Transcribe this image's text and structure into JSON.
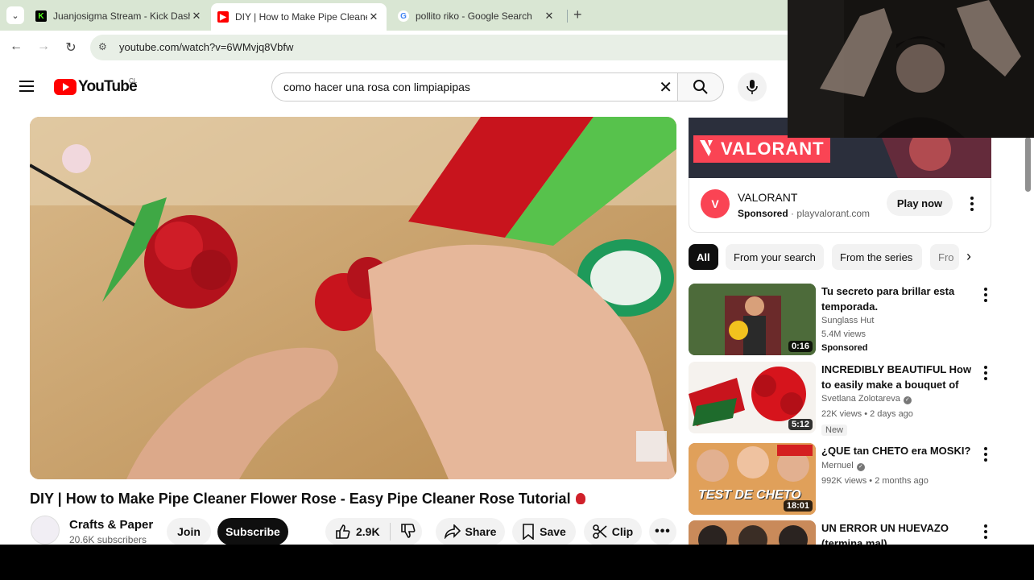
{
  "browser": {
    "tabs": [
      {
        "title": "Juanjosigma Stream - Kick Dashboard",
        "favicon": "kick-favicon",
        "color": "#53fc18"
      },
      {
        "title": "DIY | How to Make Pipe Cleaner Flower Rose",
        "favicon": "youtube-favicon",
        "color": "#ff0000"
      },
      {
        "title": "pollito riko - Google Search",
        "favicon": "google-favicon",
        "color": "#4285f4"
      }
    ],
    "url": "youtube.com/watch?v=6WMvjq8Vbfw"
  },
  "youtube": {
    "logo_text": "YouTube",
    "country": "CL",
    "search_query": "como hacer una rosa con limpiapipas"
  },
  "video": {
    "title": "DIY | How to Make Pipe Cleaner Flower Rose - Easy Pipe Cleaner Rose Tutorial",
    "channel": "Crafts & Paper",
    "subscribers": "20.6K subscribers",
    "join_label": "Join",
    "subscribe_label": "Subscribe",
    "likes": "2.9K",
    "share_label": "Share",
    "save_label": "Save",
    "clip_label": "Clip"
  },
  "ad": {
    "banner_text": "VALORANT",
    "name": "VALORANT",
    "sponsored": "Sponsored",
    "domain": "playvalorant.com",
    "cta": "Play now",
    "brand_color": "#fa4454"
  },
  "chips": [
    "All",
    "From your search",
    "From the series",
    "Fro"
  ],
  "recommendations": [
    {
      "title": "Tu secreto para brillar esta temporada.",
      "channel": "Sunglass Hut",
      "meta": "5.4M views",
      "badge": "Sponsored",
      "duration": "0:16"
    },
    {
      "title": "INCREDIBLY BEAUTIFUL How to easily make a bouquet of rose...",
      "channel": "Svetlana Zolotareva",
      "meta": "22K views • 2 days ago",
      "badge": "New",
      "duration": "5:12"
    },
    {
      "title": "¿QUE tan CHETO era MOSKI?",
      "channel": "Mernuel",
      "meta": "992K views • 2 months ago",
      "duration": "18:01",
      "thumb_text": "TEST DE CHETO"
    },
    {
      "title": "UN ERROR UN HUEVAZO (termina mal)"
    }
  ]
}
